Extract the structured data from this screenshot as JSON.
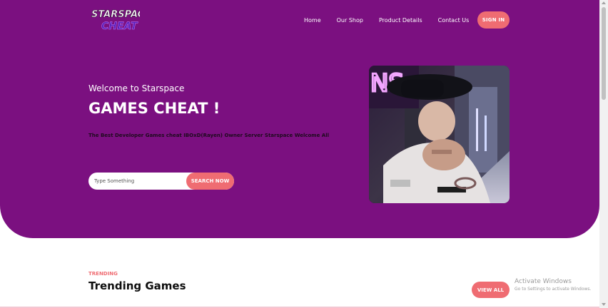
{
  "brand": {
    "logo_alt": "Starspace Cheat"
  },
  "nav": {
    "items": [
      {
        "label": "Home"
      },
      {
        "label": "Our Shop"
      },
      {
        "label": "Product Details"
      },
      {
        "label": "Contact Us"
      }
    ],
    "signin_label": "SIGN IN"
  },
  "hero": {
    "welcome": "Welcome to Starspace",
    "headline": "GAMES CHEAT !",
    "description": "The Best Developer Games cheat IBOxD(Rayen) Owner Server Starspace Welcome All",
    "search": {
      "placeholder": "Type Something",
      "value": "",
      "button_label": "SEARCH NOW"
    }
  },
  "trending": {
    "label": "TRENDING",
    "title": "Trending Games",
    "view_all_label": "VIEW ALL"
  },
  "system": {
    "activate_title": "Activate Windows",
    "activate_sub": "Go to Settings to activate Windows."
  },
  "colors": {
    "hero_bg": "#7b1080",
    "accent": "#ef6c72",
    "page_bg": "#ffffff"
  },
  "icons": {
    "logo": "starspace-logo-icon",
    "hero_image": "person-photo"
  }
}
